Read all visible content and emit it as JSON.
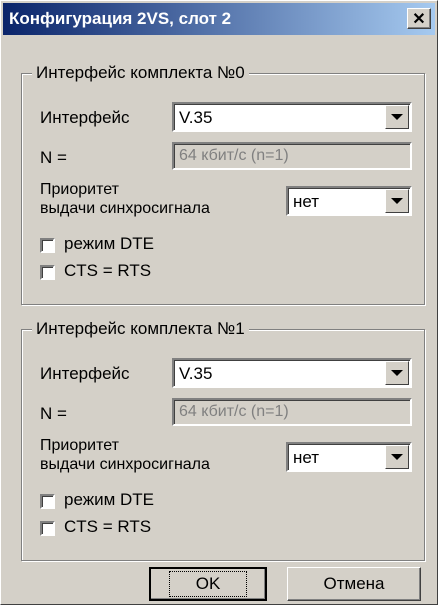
{
  "window": {
    "title": "Конфигурация 2VS, слот 2",
    "close_glyph": "✕"
  },
  "groups": [
    {
      "title": "Интерфейс комплекта №0",
      "interface_label": "Интерфейс",
      "interface_value": "V.35",
      "n_label": "N =",
      "n_value": "64 кбит/с (n=1)",
      "priority_label_line1": "Приоритет",
      "priority_label_line2": "выдачи синхросигнала",
      "priority_value": "нет",
      "dte_label": "режим DTE",
      "cts_label": "CTS = RTS"
    },
    {
      "title": "Интерфейс комплекта №1",
      "interface_label": "Интерфейс",
      "interface_value": "V.35",
      "n_label": "N =",
      "n_value": "64 кбит/с (n=1)",
      "priority_label_line1": "Приоритет",
      "priority_label_line2": "выдачи синхросигнала",
      "priority_value": "нет",
      "dte_label": "режим DTE",
      "cts_label": "CTS = RTS"
    }
  ],
  "buttons": {
    "ok": "OK",
    "cancel": "Отмена"
  },
  "checkbox_states": {
    "dte_0": false,
    "cts_0": false,
    "dte_1": false,
    "cts_1": false
  },
  "colors": {
    "face": "#d4d0c8",
    "title_start": "#0a246a",
    "title_end": "#a6caf0"
  }
}
